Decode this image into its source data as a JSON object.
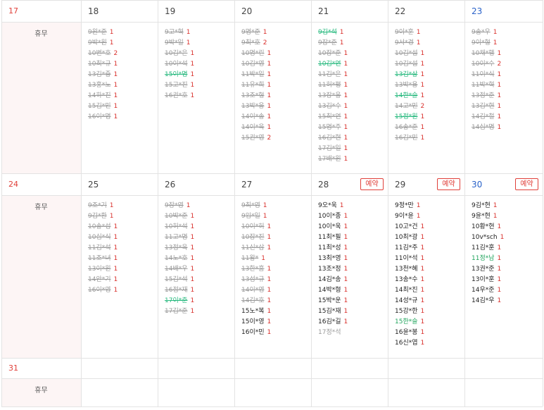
{
  "calendar": {
    "book_label": "예약",
    "holiday_label": "휴무",
    "weeks": [
      {
        "days": [
          {
            "num": "17",
            "kind": "sun",
            "holiday": true,
            "entries": []
          },
          {
            "num": "18",
            "entries": [
              {
                "name": "9원*준",
                "count": "1"
              },
              {
                "name": "9박*원",
                "count": "1"
              },
              {
                "name": "10변*호",
                "count": "2"
              },
              {
                "name": "10최*규",
                "count": "1"
              },
              {
                "name": "13김*중",
                "count": "1"
              },
              {
                "name": "13홍*노",
                "count": "1"
              },
              {
                "name": "14하*진",
                "count": "1"
              },
              {
                "name": "15김*민",
                "count": "1"
              },
              {
                "name": "16이*명",
                "count": "1"
              }
            ]
          },
          {
            "num": "19",
            "entries": [
              {
                "name": "9고*혁",
                "count": "1"
              },
              {
                "name": "9박*일",
                "count": "1"
              },
              {
                "name": "10김*은",
                "count": "1"
              },
              {
                "name": "10이*석",
                "count": "1"
              },
              {
                "name": "15이*명",
                "count": "1",
                "hl": true
              },
              {
                "name": "15고*진",
                "count": "1"
              },
              {
                "name": "16권*호",
                "count": "1"
              }
            ]
          },
          {
            "num": "20",
            "entries": [
              {
                "name": "9명*준",
                "count": "1"
              },
              {
                "name": "9최*호",
                "count": "2"
              },
              {
                "name": "10명*린",
                "count": "1"
              },
              {
                "name": "10김*영",
                "count": "1"
              },
              {
                "name": "11박*일",
                "count": "1"
              },
              {
                "name": "11유*희",
                "count": "1"
              },
              {
                "name": "13조*형",
                "count": "1"
              },
              {
                "name": "13박*웅",
                "count": "1"
              },
              {
                "name": "14이*송",
                "count": "1"
              },
              {
                "name": "14이*욱",
                "count": "1"
              },
              {
                "name": "15권*영",
                "count": "2"
              }
            ]
          },
          {
            "num": "21",
            "entries": [
              {
                "name": "9김*석",
                "count": "1",
                "hl": true
              },
              {
                "name": "9장*준",
                "count": "1"
              },
              {
                "name": "10장*준",
                "count": "1"
              },
              {
                "name": "10김*연",
                "count": "1",
                "hl": true
              },
              {
                "name": "11김*은",
                "count": "1"
              },
              {
                "name": "11허*평",
                "count": "1"
              },
              {
                "name": "13장*웅",
                "count": "1"
              },
              {
                "name": "13김*수",
                "count": "1"
              },
              {
                "name": "15최*연",
                "count": "1"
              },
              {
                "name": "15명*주",
                "count": "1"
              },
              {
                "name": "16김*현",
                "count": "1"
              },
              {
                "name": "17김*일",
                "count": "1"
              },
              {
                "name": "17배*원",
                "count": "1"
              }
            ]
          },
          {
            "num": "22",
            "entries": [
              {
                "name": "9이*훈",
                "count": "1"
              },
              {
                "name": "9서*경",
                "count": "1"
              },
              {
                "name": "10김*섭",
                "count": "1"
              },
              {
                "name": "10김*섭",
                "count": "1"
              },
              {
                "name": "13김*상",
                "count": "1",
                "hl": true
              },
              {
                "name": "13박*용",
                "count": "1"
              },
              {
                "name": "14한*슬",
                "count": "1",
                "hl": true
              },
              {
                "name": "14고*민",
                "count": "2"
              },
              {
                "name": "15정*원",
                "count": "1",
                "hl": true
              },
              {
                "name": "16송*준",
                "count": "1"
              },
              {
                "name": "16김*민",
                "count": "1"
              }
            ]
          },
          {
            "num": "23",
            "kind": "sat",
            "entries": [
              {
                "name": "9송*우",
                "count": "1"
              },
              {
                "name": "9이*형",
                "count": "1"
              },
              {
                "name": "10채*행",
                "count": "1"
              },
              {
                "name": "10이*수",
                "count": "2"
              },
              {
                "name": "11이*식",
                "count": "1"
              },
              {
                "name": "11박*혁",
                "count": "1"
              },
              {
                "name": "13정*준",
                "count": "1"
              },
              {
                "name": "13김*현",
                "count": "1"
              },
              {
                "name": "14김*철",
                "count": "1"
              },
              {
                "name": "14심*명",
                "count": "1"
              }
            ]
          }
        ]
      },
      {
        "days": [
          {
            "num": "24",
            "kind": "sun",
            "holiday": true,
            "entries": []
          },
          {
            "num": "25",
            "entries": [
              {
                "name": "9조*기",
                "count": "1"
              },
              {
                "name": "9김*환",
                "count": "1"
              },
              {
                "name": "10송*성",
                "count": "1"
              },
              {
                "name": "10심*식",
                "count": "1"
              },
              {
                "name": "11김*석",
                "count": "1"
              },
              {
                "name": "11조*녀",
                "count": "1"
              },
              {
                "name": "13이*원",
                "count": "1"
              },
              {
                "name": "14안*기",
                "count": "1"
              },
              {
                "name": "16이*영",
                "count": "1"
              }
            ]
          },
          {
            "num": "26",
            "entries": [
              {
                "name": "9장*영",
                "count": "1"
              },
              {
                "name": "10박*준",
                "count": "1"
              },
              {
                "name": "10허*석",
                "count": "1"
              },
              {
                "name": "11고*명",
                "count": "1"
              },
              {
                "name": "13정*욱",
                "count": "1"
              },
              {
                "name": "14노*호",
                "count": "1"
              },
              {
                "name": "14배*우",
                "count": "1"
              },
              {
                "name": "15김*석",
                "count": "1"
              },
              {
                "name": "16정*재",
                "count": "1"
              },
              {
                "name": "17이*준",
                "count": "1",
                "hl": true
              },
              {
                "name": "17김*준",
                "count": "1"
              }
            ]
          },
          {
            "num": "27",
            "entries": [
              {
                "name": "9최*영",
                "count": "1"
              },
              {
                "name": "9임*일",
                "count": "1"
              },
              {
                "name": "10이*허",
                "count": "1"
              },
              {
                "name": "10장*진",
                "count": "1"
              },
              {
                "name": "11신*삼",
                "count": "1"
              },
              {
                "name": "11왕*",
                "count": "1"
              },
              {
                "name": "13한*흠",
                "count": "1"
              },
              {
                "name": "13성*규",
                "count": "1"
              },
              {
                "name": "14이*영",
                "count": "1"
              },
              {
                "name": "14김*호",
                "count": "1"
              },
              {
                "name": "15노*복",
                "count": "1",
                "active": true
              },
              {
                "name": "15이*영",
                "count": "1",
                "active": true
              },
              {
                "name": "16이*민",
                "count": "1",
                "active": true
              }
            ]
          },
          {
            "num": "28",
            "book": true,
            "entries": [
              {
                "name": "9오*욱",
                "count": "1",
                "active": true
              },
              {
                "name": "10이*종",
                "count": "1",
                "active": true
              },
              {
                "name": "10이*욱",
                "count": "1",
                "active": true
              },
              {
                "name": "11최*필",
                "count": "1",
                "active": true
              },
              {
                "name": "11최*성",
                "count": "1",
                "active": true
              },
              {
                "name": "13최*영",
                "count": "1",
                "active": true
              },
              {
                "name": "13조*정",
                "count": "1",
                "active": true
              },
              {
                "name": "14김*송",
                "count": "1",
                "active": true
              },
              {
                "name": "14박*형",
                "count": "1",
                "active": true
              },
              {
                "name": "15박*운",
                "count": "1",
                "active": true
              },
              {
                "name": "15김*재",
                "count": "1",
                "active": true
              },
              {
                "name": "16김*길",
                "count": "1",
                "active": true
              },
              {
                "name": "17정*석",
                "count": "",
                "pending": true
              }
            ]
          },
          {
            "num": "29",
            "book": true,
            "entries": [
              {
                "name": "9정*만",
                "count": "1",
                "active": true
              },
              {
                "name": "9이*윤",
                "count": "1",
                "active": true
              },
              {
                "name": "10고*건",
                "count": "1",
                "active": true
              },
              {
                "name": "10최*광",
                "count": "1",
                "active": true
              },
              {
                "name": "11김*주",
                "count": "1",
                "active": true
              },
              {
                "name": "11이*석",
                "count": "1",
                "active": true
              },
              {
                "name": "13천*혜",
                "count": "1",
                "active": true
              },
              {
                "name": "13송*수",
                "count": "1",
                "active": true
              },
              {
                "name": "14최*진",
                "count": "1",
                "active": true
              },
              {
                "name": "14성*규",
                "count": "1",
                "active": true
              },
              {
                "name": "15강*한",
                "count": "1",
                "active": true
              },
              {
                "name": "15한*슬",
                "count": "1",
                "active": true,
                "hl": true
              },
              {
                "name": "16윤*봉",
                "count": "1",
                "active": true
              },
              {
                "name": "16신*엽",
                "count": "1",
                "active": true
              }
            ]
          },
          {
            "num": "30",
            "kind": "sat",
            "book": true,
            "entries": [
              {
                "name": "9김*현",
                "count": "1",
                "active": true
              },
              {
                "name": "9윤*현",
                "count": "1",
                "active": true
              },
              {
                "name": "10황*현",
                "count": "1",
                "active": true
              },
              {
                "name": "10v*sch",
                "count": "1",
                "active": true
              },
              {
                "name": "11김*훈",
                "count": "1",
                "active": true
              },
              {
                "name": "11정*남",
                "count": "1",
                "active": true,
                "hl": true
              },
              {
                "name": "13권*준",
                "count": "1",
                "active": true
              },
              {
                "name": "13이*훈",
                "count": "1",
                "active": true
              },
              {
                "name": "14우*준",
                "count": "1",
                "active": true
              },
              {
                "name": "14김*우",
                "count": "1",
                "active": true
              }
            ]
          }
        ]
      },
      {
        "days": [
          {
            "num": "31",
            "kind": "sun",
            "holiday": true,
            "entries": []
          },
          {
            "num": "",
            "entries": []
          },
          {
            "num": "",
            "entries": []
          },
          {
            "num": "",
            "entries": []
          },
          {
            "num": "",
            "entries": []
          },
          {
            "num": "",
            "entries": []
          },
          {
            "num": "",
            "entries": []
          }
        ]
      }
    ]
  }
}
